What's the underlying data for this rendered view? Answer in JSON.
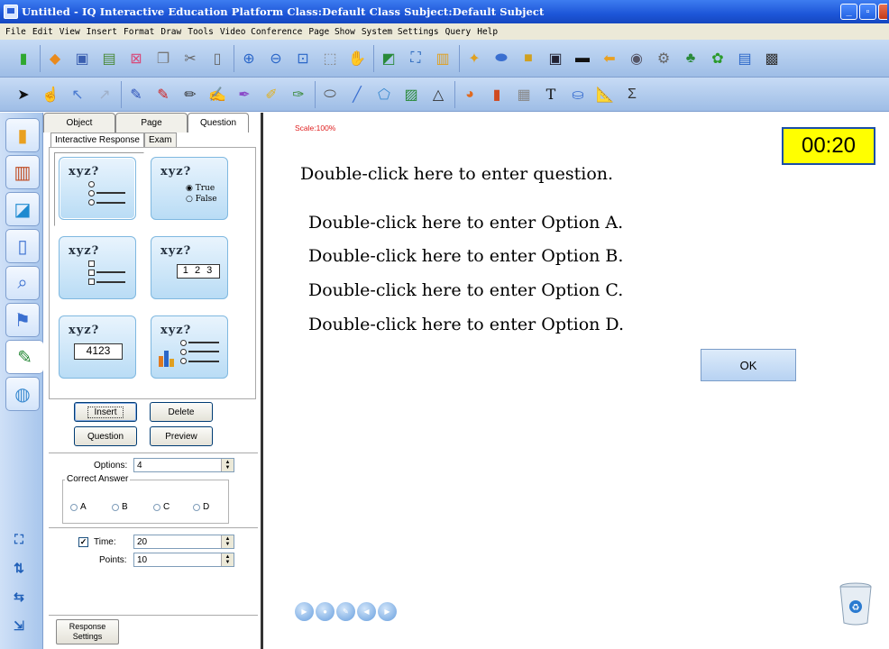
{
  "window": {
    "title": "Untitled - IQ Interactive Education Platform  Class:Default Class  Subject:Default Subject",
    "minimize": "_",
    "maximize": "▫",
    "close": "x"
  },
  "menu": [
    "File",
    "Edit",
    "View",
    "Insert",
    "Format",
    "Draw",
    "Tools",
    "Video Conference",
    "Page Show",
    "System Settings",
    "Query",
    "Help"
  ],
  "toolbar1": [
    "new-page-icon",
    "open-icon",
    "save-icon",
    "image-icon",
    "clear-icon",
    "copy-icon",
    "cut-icon",
    "paste-icon",
    "zoom-in-icon",
    "zoom-out-icon",
    "zoom-menu-icon",
    "fit-icon",
    "hand-icon",
    "screen-capture-icon",
    "fullscreen-icon",
    "record-icon",
    "magic-icon",
    "eraser-icon",
    "board-icon",
    "monitor-icon",
    "screen-icon",
    "back-icon",
    "camera-icon",
    "tools-icon",
    "classroom-icon",
    "paint-icon",
    "window-icon",
    "stop-icon"
  ],
  "toolbar2": [
    "select-arrow-icon",
    "hand-pointer-icon",
    "arrow-icon",
    "line-arrow-icon",
    "pen-icon",
    "red-pen-icon",
    "pencil-icon",
    "highlighter-icon",
    "marker-icon",
    "brush-icon",
    "smart-pen-icon",
    "ellipse-icon",
    "line-icon",
    "shape-icon",
    "chart-icon",
    "triangle-icon",
    "pie-icon",
    "bar-icon",
    "table-icon",
    "text-icon",
    "fill-icon",
    "ruler-icon",
    "formula-icon"
  ],
  "panel": {
    "tabs": [
      "Object",
      "Page",
      "Question"
    ],
    "active_tab": "Question",
    "subtabs": [
      "Interactive Response",
      "Exam"
    ],
    "active_subtab": "Interactive Response",
    "qtypes": [
      {
        "label": "xyz?",
        "kind": "single-choice"
      },
      {
        "label": "xyz?",
        "kind": "true-false",
        "true": "True",
        "false": "False"
      },
      {
        "label": "xyz?",
        "kind": "multiple-choice"
      },
      {
        "label": "xyz?",
        "kind": "ordering",
        "box": "1 2 3"
      },
      {
        "label": "xyz?",
        "kind": "numeric",
        "box": "4123"
      },
      {
        "label": "xyz?",
        "kind": "poll"
      }
    ],
    "buttons": {
      "insert": "Insert",
      "delete": "Delete",
      "question": "Question",
      "preview": "Preview"
    },
    "options_label": "Options:",
    "options_value": "4",
    "correct_answer": {
      "title": "Correct Answer",
      "choices": [
        "A",
        "B",
        "C",
        "D"
      ]
    },
    "time_label": "Time:",
    "time_checked": true,
    "time_value": "20",
    "points_label": "Points:",
    "points_value": "10",
    "response_settings": "Response Settings"
  },
  "canvas": {
    "scale": "Scale:100%",
    "timer": "00:20",
    "question": "Double-click here to enter question.",
    "options": [
      "Double-click here to enter Option A.",
      "Double-click here to enter Option B.",
      "Double-click here to enter Option C.",
      "Double-click here to enter Option D."
    ],
    "ok": "OK"
  },
  "colors": {
    "timer_bg": "#ffff00",
    "scale_text": "#e02020",
    "titlebar": "#1d56d8"
  }
}
